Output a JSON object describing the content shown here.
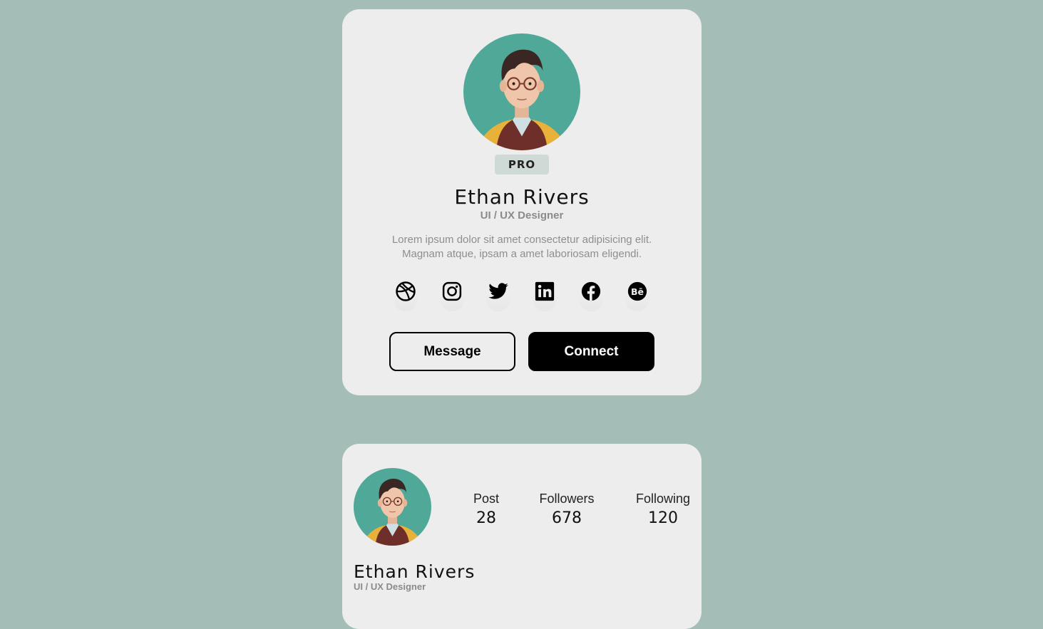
{
  "profile_card": {
    "badge": "PRO",
    "name": "Ethan Rivers",
    "role": "UI / UX Designer",
    "bio_line1": "Lorem ipsum dolor sit amet consectetur adipisicing elit.",
    "bio_line2": "Magnam atque, ipsam a amet laboriosam eligendi.",
    "socials": [
      {
        "icon": "dribbble-icon"
      },
      {
        "icon": "instagram-icon"
      },
      {
        "icon": "twitter-icon"
      },
      {
        "icon": "linkedin-icon"
      },
      {
        "icon": "facebook-icon"
      },
      {
        "icon": "behance-icon"
      }
    ],
    "message_label": "Message",
    "connect_label": "Connect"
  },
  "stats_card": {
    "stats": [
      {
        "label": "Post",
        "value": "28"
      },
      {
        "label": "Followers",
        "value": "678"
      },
      {
        "label": "Following",
        "value": "120"
      }
    ],
    "name": "Ethan Rivers",
    "role": "UI / UX Designer"
  },
  "colors": {
    "background": "#a4bdb6",
    "card": "#ededed",
    "badge": "#cfdad6",
    "primary": "#000000"
  }
}
